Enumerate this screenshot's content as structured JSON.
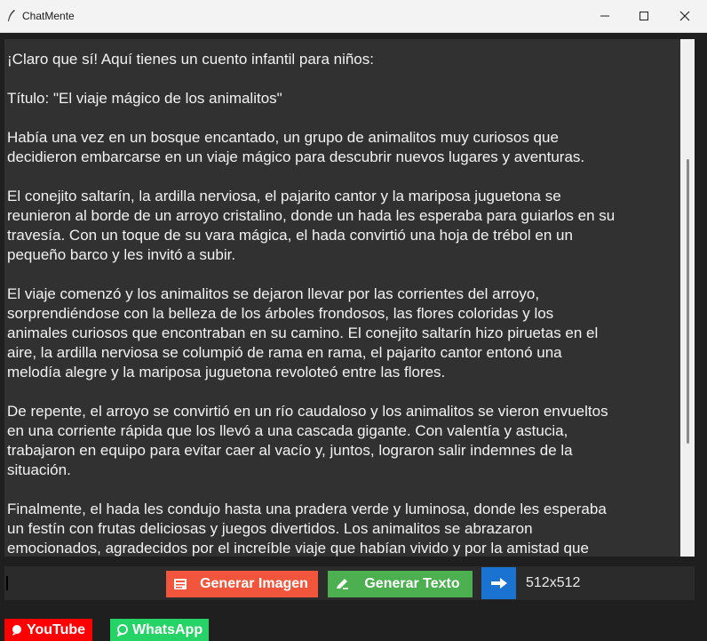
{
  "window": {
    "title": "ChatMente",
    "icon": "feather-pen-icon"
  },
  "chat": {
    "paragraphs": [
      "¡Claro que sí! Aquí tienes un cuento infantil para niños:",
      "Título: \"El viaje mágico de los animalitos\"",
      "Había una vez en un bosque encantado, un grupo de animalitos muy curiosos que\ndecidieron embarcarse en un viaje mágico para descubrir nuevos lugares y aventuras.",
      "El conejito saltarín, la ardilla nerviosa, el pajarito cantor y la mariposa juguetona se\nreunieron al borde de un arroyo cristalino, donde un hada les esperaba para guiarlos en su\ntravesía. Con un toque de su vara mágica, el hada convirtió una hoja de trébol en un\npequeño barco y les invitó a subir.",
      "El viaje comenzó y los animalitos se dejaron llevar por las corrientes del arroyo,\nsorprendiéndose con la belleza de los árboles frondosos, las flores coloridas y los\nanimales curiosos que encontraban en su camino. El conejito saltarín hizo piruetas en el\naire, la ardilla nerviosa se columpió de rama en rama, el pajarito cantor entonó una\nmelodía alegre y la mariposa juguetona revoloteó entre las flores.",
      "De repente, el arroyo se convirtió en un río caudaloso y los animalitos se vieron envueltos\nen una corriente rápida que los llevó a una cascada gigante. Con valentía y astucia,\ntrabajaron en equipo para evitar caer al vacío y, juntos, lograron salir indemnes de la\nsituación.",
      "Finalmente, el hada les condujo hasta una pradera verde y luminosa, donde les esperaba\nun festín con frutas deliciosas y juegos divertidos. Los animalitos se abrazaron\nemocionados, agradecidos por el increíble viaje que habían vivido y por la amistad que"
    ]
  },
  "toolbar": {
    "prompt_value": "",
    "generate_image_label": "Generar Imagen",
    "generate_image_icon": "image-file-icon",
    "generate_text_label": "Generar Texto",
    "generate_text_icon": "pencil-icon",
    "arrow_icon": "arrow-right-icon",
    "size_label": "512x512"
  },
  "social": {
    "youtube_label": "YouTube",
    "whatsapp_label": "WhatsApp"
  },
  "colors": {
    "image_button": "#f1563c",
    "text_button": "#4caf50",
    "arrow_button": "#1a73d1",
    "youtube": "#ff0000",
    "whatsapp": "#25d366"
  }
}
